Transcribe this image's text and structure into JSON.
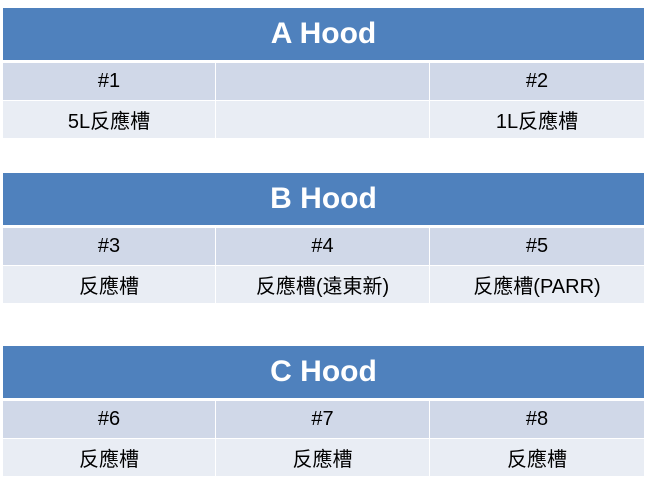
{
  "tables": [
    {
      "title": "A Hood",
      "ids": [
        "#1",
        "",
        "#2"
      ],
      "descs": [
        "5L反應槽",
        "",
        "1L反應槽"
      ]
    },
    {
      "title": "B Hood",
      "ids": [
        "#3",
        "#4",
        "#5"
      ],
      "descs": [
        "反應槽",
        "反應槽(遠東新)",
        "反應槽(PARR)"
      ]
    },
    {
      "title": "C Hood",
      "ids": [
        "#6",
        "#7",
        "#8"
      ],
      "descs": [
        "反應槽",
        "反應槽",
        "反應槽"
      ]
    }
  ],
  "colors": {
    "header": "#4f81bd",
    "row_dark": "#d0d8e8",
    "row_light": "#e9edf4"
  }
}
